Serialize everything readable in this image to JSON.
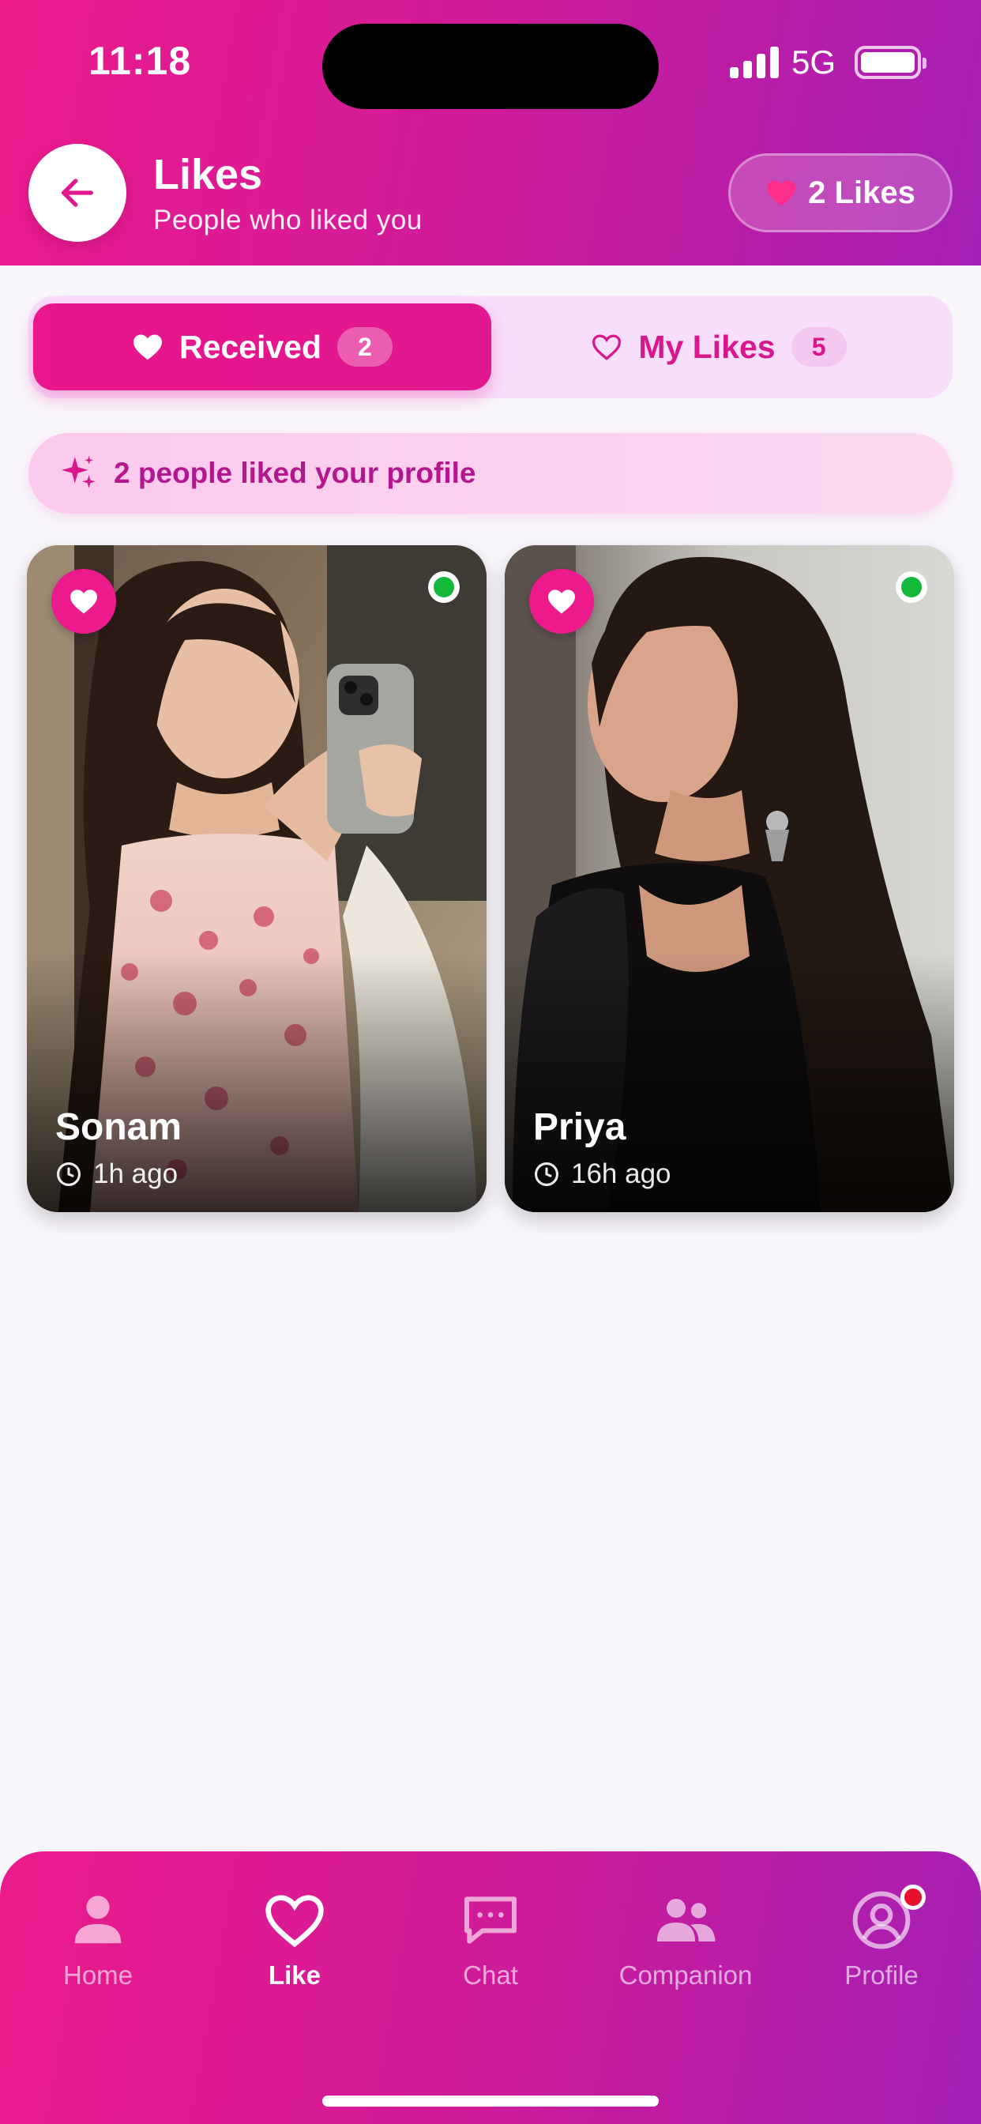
{
  "status_bar": {
    "time": "11:18",
    "network": "5G",
    "icons": [
      "signal-icon",
      "battery-icon"
    ]
  },
  "header": {
    "title": "Likes",
    "subtitle": "People who liked you",
    "likes_pill": "2 Likes",
    "back_icon": "arrow-left-icon"
  },
  "tabs": [
    {
      "label": "Received",
      "count": "2",
      "active": true,
      "icon": "heart-filled-icon"
    },
    {
      "label": "My Likes",
      "count": "5",
      "active": false,
      "icon": "heart-outline-icon"
    }
  ],
  "banner": {
    "text": "2 people liked your profile",
    "icon": "sparkles-icon"
  },
  "cards": [
    {
      "name": "Sonam",
      "time": "1h ago",
      "online": true
    },
    {
      "name": "Priya",
      "time": "16h ago",
      "online": true
    }
  ],
  "bottom_nav": [
    {
      "label": "Home",
      "icon": "person-icon",
      "active": false
    },
    {
      "label": "Like",
      "icon": "heart-outline-icon",
      "active": true
    },
    {
      "label": "Chat",
      "icon": "chat-bubble-icon",
      "active": false
    },
    {
      "label": "Companion",
      "icon": "people-icon",
      "active": false
    },
    {
      "label": "Profile",
      "icon": "profile-circle-icon",
      "active": false,
      "notification": true
    }
  ],
  "colors": {
    "primary_pink": "#ec1a8c",
    "gradient_end_purple": "#a61fb4",
    "online_green": "#14b83b",
    "notification_red": "#e8112d",
    "banner_text": "#b3168d"
  }
}
